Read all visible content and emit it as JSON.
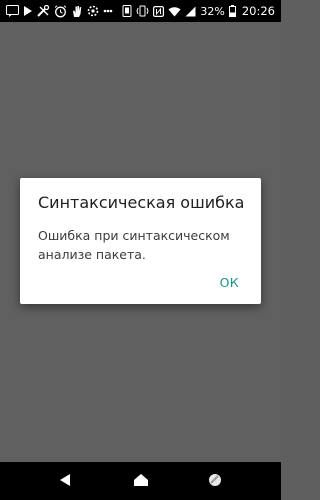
{
  "status_bar": {
    "battery_percent": "32%",
    "time": "20:26",
    "icons_left": [
      "notification-icon",
      "play-icon",
      "tools-icon",
      "alarm-icon",
      "hand-icon",
      "settings-icon",
      "more-icon"
    ],
    "icons_right": [
      "screen-icon",
      "vibrate-icon",
      "nfc-icon",
      "wifi-icon",
      "signal-icon",
      "battery-icon"
    ]
  },
  "dialog": {
    "title": "Синтаксическая ошибка",
    "message": "Ошибка при синтаксическом анализе пакета.",
    "ok_label": "ОК"
  },
  "nav_bar": {
    "icons": [
      "back-icon",
      "home-icon",
      "recents-icon"
    ]
  },
  "colors": {
    "background_dim": "#606060",
    "dialog_bg": "#ffffff",
    "accent": "#18958a",
    "bars": "#000000"
  }
}
